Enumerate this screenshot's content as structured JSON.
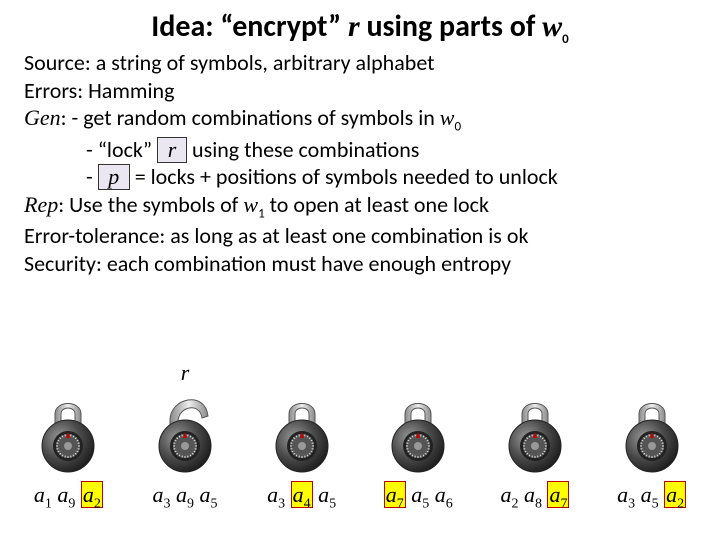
{
  "title": {
    "prefix": "Idea: “encrypt” ",
    "r": "r",
    "mid": " using parts of ",
    "w": "w",
    "wsub": "0"
  },
  "lines": {
    "source": "Source: a string of symbols, arbitrary alphabet",
    "errors": "Errors: Hamming",
    "gen_lbl": "Gen",
    "gen_rest": ": - get random combinations of symbols in ",
    "gen_w": "w",
    "gen_wsub": "0",
    "gen2_pre": "- “lock” ",
    "gen2_r": "r",
    "gen2_post": " using these combinations",
    "gen3_pre": "-  ",
    "gen3_p": "p",
    "gen3_post": " = locks + positions of symbols needed to unlock",
    "rep_lbl": "Rep",
    "rep_rest": ":  Use the symbols of ",
    "rep_w": "w",
    "rep_wsub": "1",
    "rep_post": " to open at least one lock",
    "tol": "Error-tolerance: as long as at least one combination is ok",
    "sec": "Security: each combination must have enough entropy"
  },
  "r_over": "r",
  "locks": [
    {
      "open": false,
      "symbols": [
        {
          "a": "a",
          "i": "1",
          "hl": false
        },
        {
          "a": "a",
          "i": "9",
          "hl": false
        },
        {
          "a": "a",
          "i": "2",
          "hl": true
        }
      ]
    },
    {
      "open": true,
      "symbols": [
        {
          "a": "a",
          "i": "3",
          "hl": false
        },
        {
          "a": "a",
          "i": "9",
          "hl": false
        },
        {
          "a": "a",
          "i": "5",
          "hl": false
        }
      ]
    },
    {
      "open": false,
      "symbols": [
        {
          "a": "a",
          "i": "3",
          "hl": false
        },
        {
          "a": "a",
          "i": "4",
          "hl": true
        },
        {
          "a": "a",
          "i": "5",
          "hl": false
        }
      ]
    },
    {
      "open": false,
      "symbols": [
        {
          "a": "a",
          "i": "7",
          "hl": true
        },
        {
          "a": "a",
          "i": "5",
          "hl": false
        },
        {
          "a": "a",
          "i": "6",
          "hl": false
        }
      ]
    },
    {
      "open": false,
      "symbols": [
        {
          "a": "a",
          "i": "2",
          "hl": false
        },
        {
          "a": "a",
          "i": "8",
          "hl": false
        },
        {
          "a": "a",
          "i": "7",
          "hl": true
        }
      ]
    },
    {
      "open": false,
      "symbols": [
        {
          "a": "a",
          "i": "3",
          "hl": false
        },
        {
          "a": "a",
          "i": "5",
          "hl": false
        },
        {
          "a": "a",
          "i": "2",
          "hl": true
        }
      ]
    }
  ]
}
